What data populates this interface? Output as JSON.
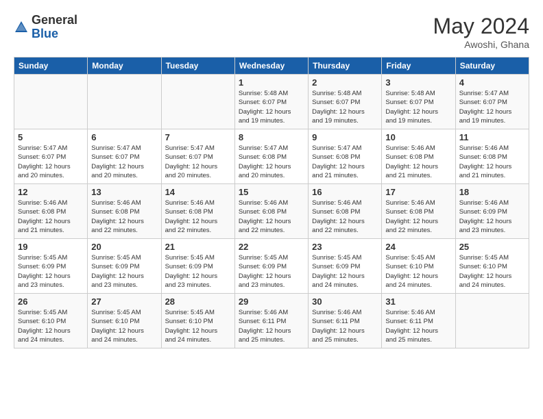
{
  "header": {
    "logo_general": "General",
    "logo_blue": "Blue",
    "month_year": "May 2024",
    "location": "Awoshi, Ghana"
  },
  "days_of_week": [
    "Sunday",
    "Monday",
    "Tuesday",
    "Wednesday",
    "Thursday",
    "Friday",
    "Saturday"
  ],
  "weeks": [
    [
      {
        "day": "",
        "info": ""
      },
      {
        "day": "",
        "info": ""
      },
      {
        "day": "",
        "info": ""
      },
      {
        "day": "1",
        "info": "Sunrise: 5:48 AM\nSunset: 6:07 PM\nDaylight: 12 hours\nand 19 minutes."
      },
      {
        "day": "2",
        "info": "Sunrise: 5:48 AM\nSunset: 6:07 PM\nDaylight: 12 hours\nand 19 minutes."
      },
      {
        "day": "3",
        "info": "Sunrise: 5:48 AM\nSunset: 6:07 PM\nDaylight: 12 hours\nand 19 minutes."
      },
      {
        "day": "4",
        "info": "Sunrise: 5:47 AM\nSunset: 6:07 PM\nDaylight: 12 hours\nand 19 minutes."
      }
    ],
    [
      {
        "day": "5",
        "info": "Sunrise: 5:47 AM\nSunset: 6:07 PM\nDaylight: 12 hours\nand 20 minutes."
      },
      {
        "day": "6",
        "info": "Sunrise: 5:47 AM\nSunset: 6:07 PM\nDaylight: 12 hours\nand 20 minutes."
      },
      {
        "day": "7",
        "info": "Sunrise: 5:47 AM\nSunset: 6:07 PM\nDaylight: 12 hours\nand 20 minutes."
      },
      {
        "day": "8",
        "info": "Sunrise: 5:47 AM\nSunset: 6:08 PM\nDaylight: 12 hours\nand 20 minutes."
      },
      {
        "day": "9",
        "info": "Sunrise: 5:47 AM\nSunset: 6:08 PM\nDaylight: 12 hours\nand 21 minutes."
      },
      {
        "day": "10",
        "info": "Sunrise: 5:46 AM\nSunset: 6:08 PM\nDaylight: 12 hours\nand 21 minutes."
      },
      {
        "day": "11",
        "info": "Sunrise: 5:46 AM\nSunset: 6:08 PM\nDaylight: 12 hours\nand 21 minutes."
      }
    ],
    [
      {
        "day": "12",
        "info": "Sunrise: 5:46 AM\nSunset: 6:08 PM\nDaylight: 12 hours\nand 21 minutes."
      },
      {
        "day": "13",
        "info": "Sunrise: 5:46 AM\nSunset: 6:08 PM\nDaylight: 12 hours\nand 22 minutes."
      },
      {
        "day": "14",
        "info": "Sunrise: 5:46 AM\nSunset: 6:08 PM\nDaylight: 12 hours\nand 22 minutes."
      },
      {
        "day": "15",
        "info": "Sunrise: 5:46 AM\nSunset: 6:08 PM\nDaylight: 12 hours\nand 22 minutes."
      },
      {
        "day": "16",
        "info": "Sunrise: 5:46 AM\nSunset: 6:08 PM\nDaylight: 12 hours\nand 22 minutes."
      },
      {
        "day": "17",
        "info": "Sunrise: 5:46 AM\nSunset: 6:08 PM\nDaylight: 12 hours\nand 22 minutes."
      },
      {
        "day": "18",
        "info": "Sunrise: 5:46 AM\nSunset: 6:09 PM\nDaylight: 12 hours\nand 23 minutes."
      }
    ],
    [
      {
        "day": "19",
        "info": "Sunrise: 5:45 AM\nSunset: 6:09 PM\nDaylight: 12 hours\nand 23 minutes."
      },
      {
        "day": "20",
        "info": "Sunrise: 5:45 AM\nSunset: 6:09 PM\nDaylight: 12 hours\nand 23 minutes."
      },
      {
        "day": "21",
        "info": "Sunrise: 5:45 AM\nSunset: 6:09 PM\nDaylight: 12 hours\nand 23 minutes."
      },
      {
        "day": "22",
        "info": "Sunrise: 5:45 AM\nSunset: 6:09 PM\nDaylight: 12 hours\nand 23 minutes."
      },
      {
        "day": "23",
        "info": "Sunrise: 5:45 AM\nSunset: 6:09 PM\nDaylight: 12 hours\nand 24 minutes."
      },
      {
        "day": "24",
        "info": "Sunrise: 5:45 AM\nSunset: 6:10 PM\nDaylight: 12 hours\nand 24 minutes."
      },
      {
        "day": "25",
        "info": "Sunrise: 5:45 AM\nSunset: 6:10 PM\nDaylight: 12 hours\nand 24 minutes."
      }
    ],
    [
      {
        "day": "26",
        "info": "Sunrise: 5:45 AM\nSunset: 6:10 PM\nDaylight: 12 hours\nand 24 minutes."
      },
      {
        "day": "27",
        "info": "Sunrise: 5:45 AM\nSunset: 6:10 PM\nDaylight: 12 hours\nand 24 minutes."
      },
      {
        "day": "28",
        "info": "Sunrise: 5:45 AM\nSunset: 6:10 PM\nDaylight: 12 hours\nand 24 minutes."
      },
      {
        "day": "29",
        "info": "Sunrise: 5:46 AM\nSunset: 6:11 PM\nDaylight: 12 hours\nand 25 minutes."
      },
      {
        "day": "30",
        "info": "Sunrise: 5:46 AM\nSunset: 6:11 PM\nDaylight: 12 hours\nand 25 minutes."
      },
      {
        "day": "31",
        "info": "Sunrise: 5:46 AM\nSunset: 6:11 PM\nDaylight: 12 hours\nand 25 minutes."
      },
      {
        "day": "",
        "info": ""
      }
    ]
  ]
}
